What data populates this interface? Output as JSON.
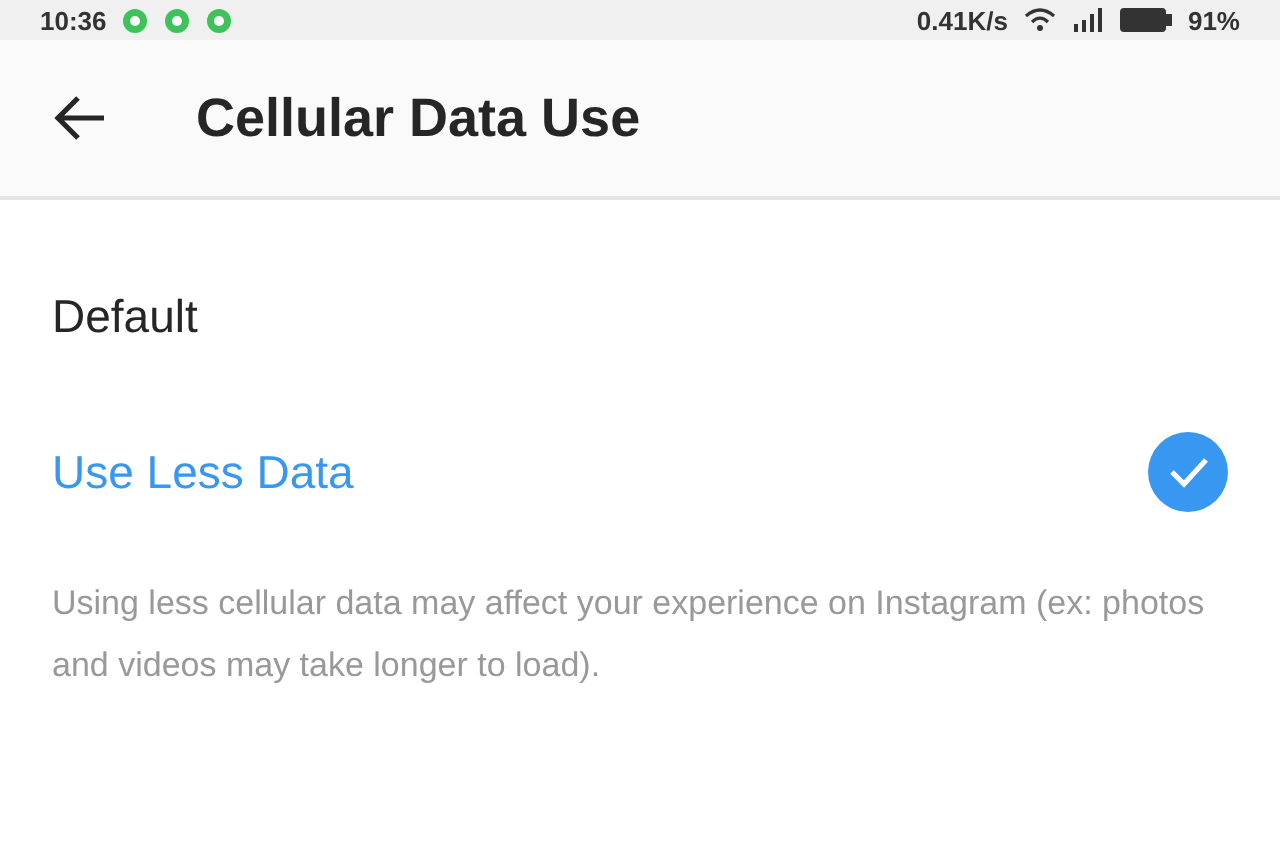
{
  "status_bar": {
    "time": "10:36",
    "speed": "0.41K/s",
    "battery": "91%"
  },
  "header": {
    "title": "Cellular Data Use"
  },
  "options": [
    {
      "label": "Default",
      "selected": false
    },
    {
      "label": "Use Less Data",
      "selected": true
    }
  ],
  "description": "Using less cellular data may affect your experience on Instagram (ex: photos and videos may take longer to load)."
}
